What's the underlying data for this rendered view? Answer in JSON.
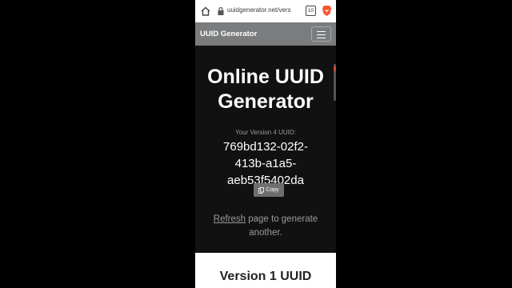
{
  "browser": {
    "url": "uuidgenerator.net/vers",
    "tab_count": "10",
    "icons": [
      "home-icon",
      "lock-icon",
      "tabs-icon",
      "brave-icon"
    ]
  },
  "navbar": {
    "brand": "UUID Generator",
    "menu_icon": "hamburger-icon"
  },
  "hero": {
    "title_line1": "Online UUID",
    "title_line2": "Generator",
    "subtitle": "Your Version 4 UUID:",
    "uuid_line1": "769bd132-02f2-",
    "uuid_line2": "413b-a1a5-",
    "uuid_line3": "aeb53f5402da",
    "copy_label": "Copy",
    "refresh_link": "Refresh",
    "refresh_rest1": " page to generate",
    "refresh_rest2": "another."
  },
  "section": {
    "title": "Version 1 UUID"
  },
  "colors": {
    "navbar": "#7a7c7e",
    "hero_bg": "#111111",
    "button": "#6c6e70",
    "brave_orange": "#fb542b"
  }
}
